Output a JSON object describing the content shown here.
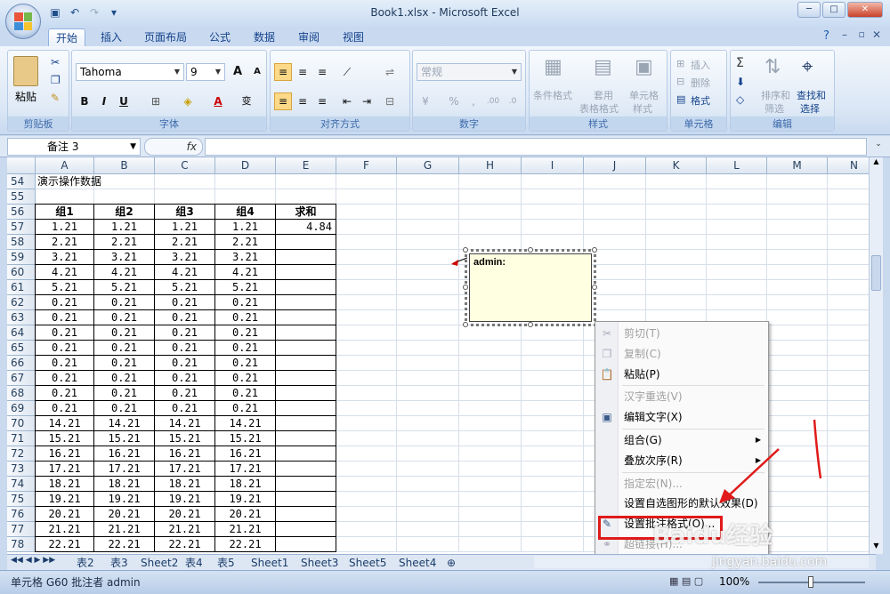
{
  "window": {
    "title": "Book1.xlsx - Microsoft Excel",
    "min": "─",
    "max": "□",
    "close": "✕"
  },
  "tabs": [
    "开始",
    "插入",
    "页面布局",
    "公式",
    "数据",
    "审阅",
    "视图"
  ],
  "ribbon": {
    "clipboard": {
      "label": "剪贴板",
      "paste": "粘贴"
    },
    "font": {
      "label": "字体",
      "name": "Tahoma",
      "size": "9",
      "bold": "B",
      "italic": "I",
      "underline": "U",
      "grow": "A",
      "shrink": "A",
      "phonetic": "变"
    },
    "alignment": {
      "label": "对齐方式"
    },
    "number": {
      "label": "数字",
      "format": "常规",
      "percent": "%",
      "comma": ","
    },
    "styles": {
      "label": "样式",
      "cond": "条件格式",
      "table_fmt_1": "套用",
      "table_fmt_2": "表格格式",
      "cell_style_1": "单元格",
      "cell_style_2": "样式"
    },
    "cells": {
      "label": "单元格",
      "insert": "插入",
      "delete": "删除",
      "format": "格式"
    },
    "editing": {
      "label": "编辑",
      "sum": "Σ",
      "sort_1": "排序和",
      "sort_2": "筛选",
      "find_1": "查找和",
      "find_2": "选择"
    }
  },
  "formula_bar": {
    "name_box": "备注 3",
    "fx": "fx",
    "value": ""
  },
  "columns": [
    "A",
    "B",
    "C",
    "D",
    "E",
    "F",
    "G",
    "H",
    "I",
    "J",
    "K",
    "L",
    "M",
    "N"
  ],
  "rows": [
    {
      "n": "54",
      "cells": [
        "演示操作数据",
        "",
        "",
        "",
        ""
      ]
    },
    {
      "n": "55",
      "cells": [
        "",
        "",
        "",
        "",
        ""
      ]
    },
    {
      "n": "56",
      "cells": [
        "组1",
        "组2",
        "组3",
        "组4",
        "求和"
      ]
    },
    {
      "n": "57",
      "cells": [
        "1.21",
        "1.21",
        "1.21",
        "1.21",
        "4.84"
      ]
    },
    {
      "n": "58",
      "cells": [
        "2.21",
        "2.21",
        "2.21",
        "2.21",
        ""
      ]
    },
    {
      "n": "59",
      "cells": [
        "3.21",
        "3.21",
        "3.21",
        "3.21",
        ""
      ]
    },
    {
      "n": "60",
      "cells": [
        "4.21",
        "4.21",
        "4.21",
        "4.21",
        ""
      ]
    },
    {
      "n": "61",
      "cells": [
        "5.21",
        "5.21",
        "5.21",
        "5.21",
        ""
      ]
    },
    {
      "n": "62",
      "cells": [
        "0.21",
        "0.21",
        "0.21",
        "0.21",
        ""
      ]
    },
    {
      "n": "63",
      "cells": [
        "0.21",
        "0.21",
        "0.21",
        "0.21",
        ""
      ]
    },
    {
      "n": "64",
      "cells": [
        "0.21",
        "0.21",
        "0.21",
        "0.21",
        ""
      ]
    },
    {
      "n": "65",
      "cells": [
        "0.21",
        "0.21",
        "0.21",
        "0.21",
        ""
      ]
    },
    {
      "n": "66",
      "cells": [
        "0.21",
        "0.21",
        "0.21",
        "0.21",
        ""
      ]
    },
    {
      "n": "67",
      "cells": [
        "0.21",
        "0.21",
        "0.21",
        "0.21",
        ""
      ]
    },
    {
      "n": "68",
      "cells": [
        "0.21",
        "0.21",
        "0.21",
        "0.21",
        ""
      ]
    },
    {
      "n": "69",
      "cells": [
        "0.21",
        "0.21",
        "0.21",
        "0.21",
        ""
      ]
    },
    {
      "n": "70",
      "cells": [
        "14.21",
        "14.21",
        "14.21",
        "14.21",
        ""
      ]
    },
    {
      "n": "71",
      "cells": [
        "15.21",
        "15.21",
        "15.21",
        "15.21",
        ""
      ]
    },
    {
      "n": "72",
      "cells": [
        "16.21",
        "16.21",
        "16.21",
        "16.21",
        ""
      ]
    },
    {
      "n": "73",
      "cells": [
        "17.21",
        "17.21",
        "17.21",
        "17.21",
        ""
      ]
    },
    {
      "n": "74",
      "cells": [
        "18.21",
        "18.21",
        "18.21",
        "18.21",
        ""
      ]
    },
    {
      "n": "75",
      "cells": [
        "19.21",
        "19.21",
        "19.21",
        "19.21",
        ""
      ]
    },
    {
      "n": "76",
      "cells": [
        "20.21",
        "20.21",
        "20.21",
        "20.21",
        ""
      ]
    },
    {
      "n": "77",
      "cells": [
        "21.21",
        "21.21",
        "21.21",
        "21.21",
        ""
      ]
    },
    {
      "n": "78",
      "cells": [
        "22.21",
        "22.21",
        "22.21",
        "22.21",
        ""
      ]
    }
  ],
  "comment": {
    "author": "admin:"
  },
  "context_menu": [
    {
      "label": "剪切(T)",
      "enabled": false,
      "icon": "scissors-icon"
    },
    {
      "label": "复制(C)",
      "enabled": false,
      "icon": "copy-icon"
    },
    {
      "label": "粘贴(P)",
      "enabled": true,
      "icon": "paste-icon"
    },
    {
      "label": "汉字重选(V)",
      "enabled": false,
      "icon": ""
    },
    {
      "label": "编辑文字(X)",
      "enabled": true,
      "icon": "edit-text-icon"
    },
    {
      "label": "组合(G)",
      "enabled": true,
      "icon": "",
      "submenu": true
    },
    {
      "label": "叠放次序(R)",
      "enabled": true,
      "icon": "",
      "submenu": true
    },
    {
      "label": "指定宏(N)...",
      "enabled": false,
      "icon": ""
    },
    {
      "label": "设置自选图形的默认效果(D)",
      "enabled": true,
      "icon": ""
    },
    {
      "label": "设置批注格式(O)...",
      "enabled": true,
      "icon": "format-comment-icon"
    },
    {
      "label": "超链接(H)...",
      "enabled": false,
      "icon": "hyperlink-icon"
    }
  ],
  "sheets": [
    "表2",
    "表3",
    "Sheet2",
    "表4",
    "表5",
    "Sheet1",
    "Sheet3",
    "Sheet5",
    "Sheet4"
  ],
  "status": {
    "text": "单元格 G60 批注者 admin",
    "zoom": "100%"
  },
  "watermark": {
    "brand": "Baidu经验",
    "url": "jingyan.baidu.com"
  }
}
